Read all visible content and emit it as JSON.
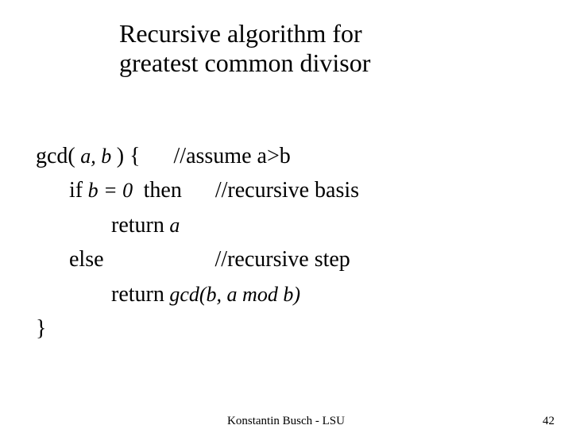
{
  "title_line1": "Recursive algorithm for",
  "title_line2": "greatest common divisor",
  "code": {
    "l1_a": "gcd(",
    "l1_math": " a, b ",
    "l1_b": ") {",
    "l1_c": "//assume a>b",
    "l2_a": "if",
    "l2_math": " b = 0 ",
    "l2_b": "then",
    "l2_c": "//recursive basis",
    "l3_a": "return",
    "l3_math": " a",
    "l4_a": "else",
    "l4_b": "//recursive step",
    "l5_a": "return",
    "l5_math": " gcd(b, a mod b)",
    "l6": "}"
  },
  "footer_center": "Konstantin Busch - LSU",
  "footer_right": "42"
}
